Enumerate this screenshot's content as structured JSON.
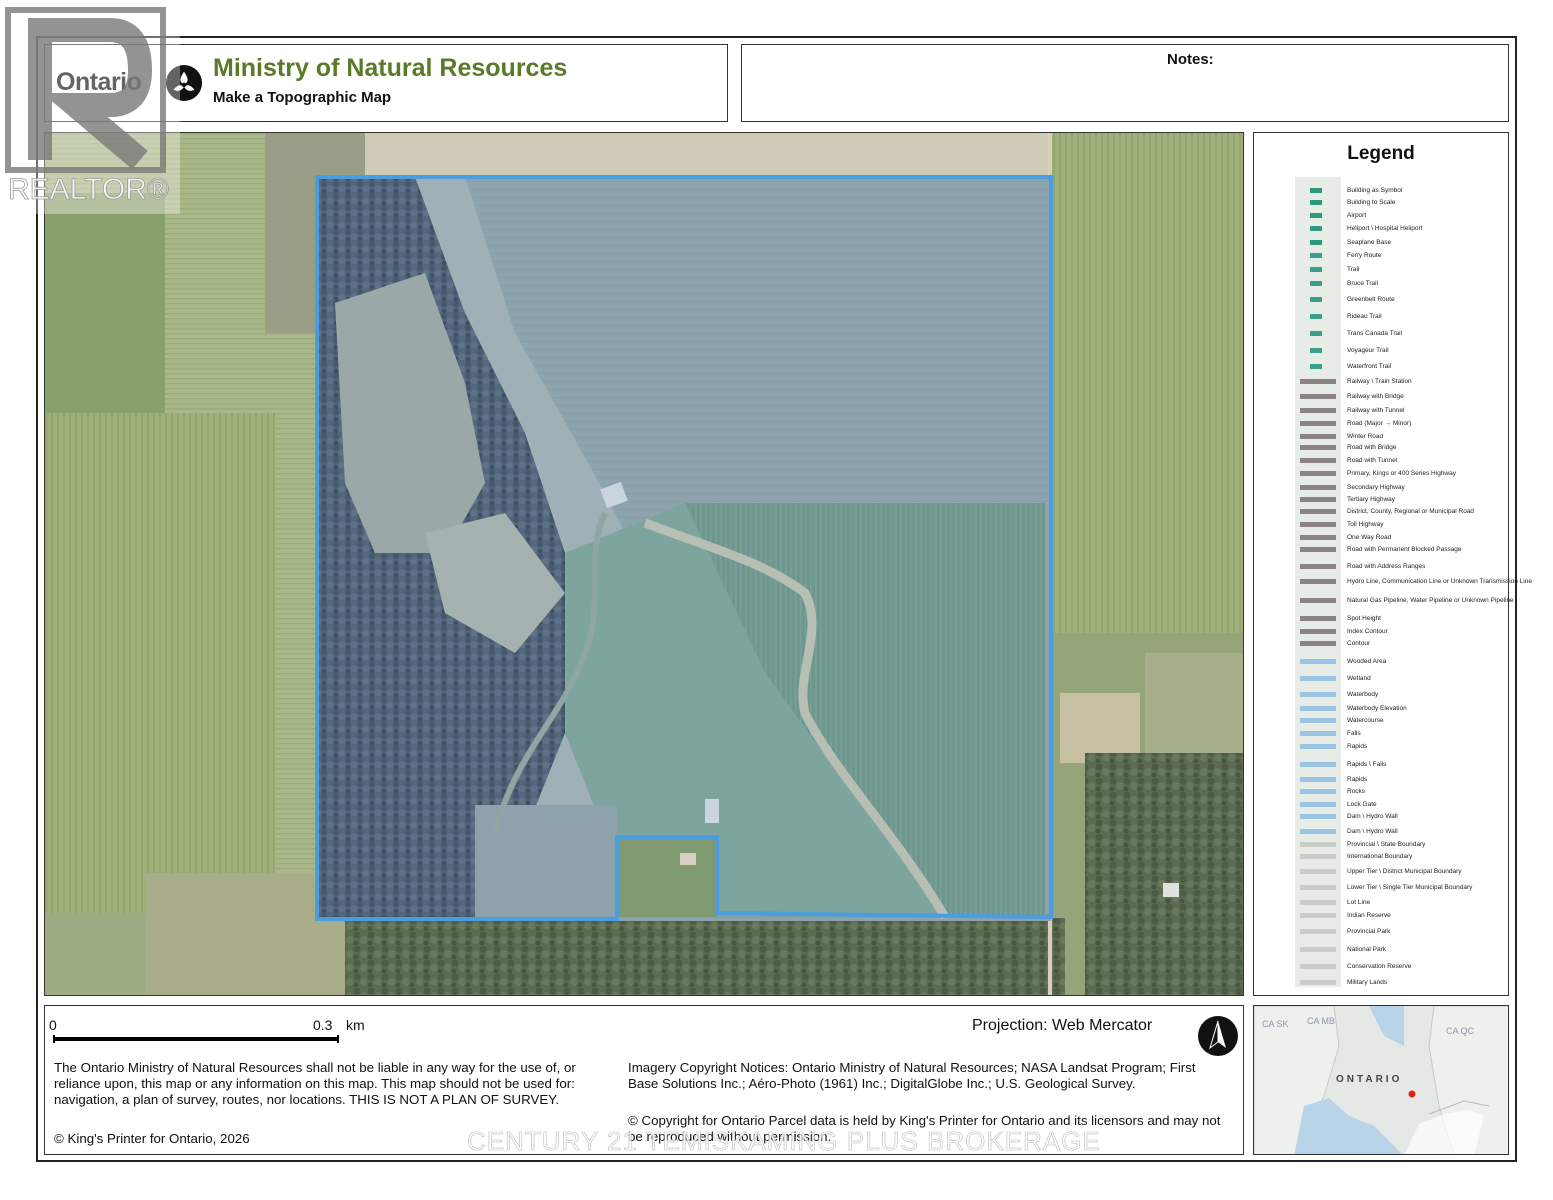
{
  "header": {
    "ontario_wordmark": "Ontario",
    "ministry": "Ministry of Natural Resources",
    "subtitle": "Make a Topographic Map",
    "notes_label": "Notes:"
  },
  "legend": {
    "title": "Legend",
    "items": [
      "Building as Symbol",
      "Building to Scale",
      "Airport",
      "Heliport \\ Hospital Heliport",
      "Seaplane Base",
      "Ferry Route",
      "Trail",
      "Bruce Trail",
      "Greenbelt Route",
      "Rideau Trail",
      "Trans Canada Trail",
      "Voyageur Trail",
      "Waterfront Trail",
      "Railway \\ Train Station",
      "Railway with Bridge",
      "Railway with Tunnel",
      "Road (Major → Minor)",
      "Winter Road",
      "Road with Bridge",
      "Road with Tunnel",
      "Primary, Kings or 400 Series Highway",
      "Secondary Highway",
      "Tertiary Highway",
      "District, County, Regional or Municipal Road",
      "Toll Highway",
      "One Way Road",
      "Road with Permanent Blocked Passage",
      "Road with Address Ranges",
      "Hydro Line, Communication Line or Unknown Transmission Line",
      "Natural Gas Pipeline, Water Pipeline or Unknown Pipeline",
      "Spot Height",
      "Index Contour",
      "Contour",
      "Wooded Area",
      "Wetland",
      "Waterbody",
      "Waterbody Elevation",
      "Watercourse",
      "Falls",
      "Rapids",
      "Rapids \\ Falls",
      "Rapids",
      "Rocks",
      "Lock Gate",
      "Dam \\ Hydro Wall",
      "Dam \\ Hydro Wall",
      "Provincial \\ State Boundary",
      "International Boundary",
      "Upper Tier \\ District Municipal Boundary",
      "Lower Tier \\ Single Tier Municipal Boundary",
      "Lot Line",
      "Indian Reserve",
      "Provincial Park",
      "National Park",
      "Conservation Reserve",
      "Military Lands"
    ]
  },
  "footer": {
    "scale_start": "0",
    "scale_end": "0.3",
    "scale_unit": "km",
    "projection": "Projection: Web Mercator",
    "disclaimer": "The Ontario Ministry of Natural Resources shall not be liable in any way for the use of, or reliance upon, this map or any information on this map.  This map should not be used for: navigation, a plan of survey, routes, nor locations. THIS IS NOT A PLAN OF SURVEY.",
    "imagery": "Imagery Copyright Notices: Ontario Ministry of Natural Resources; NASA Landsat Program; First Base Solutions Inc.; Aéro-Photo (1961) Inc.; DigitalGlobe Inc.; U.S. Geological Survey.",
    "parcel_copyright": "© Copyright for Ontario Parcel data is held by King's Printer for Ontario and its licensors and may not be reproduced without permission.",
    "kings_printer": "© King's Printer for Ontario,  2026"
  },
  "inset": {
    "labels": [
      "CA SK",
      "CA MB",
      "CA QC"
    ],
    "province": "ONTARIO"
  },
  "watermarks": {
    "realtor": "REALTOR®",
    "brokerage": "CENTURY 21 TEMISKAMING PLUS BROKERAGE"
  },
  "colors": {
    "ministry_green": "#5a7a2a",
    "parcel_outline": "#4a9ee0",
    "location_dot": "#e02020"
  }
}
